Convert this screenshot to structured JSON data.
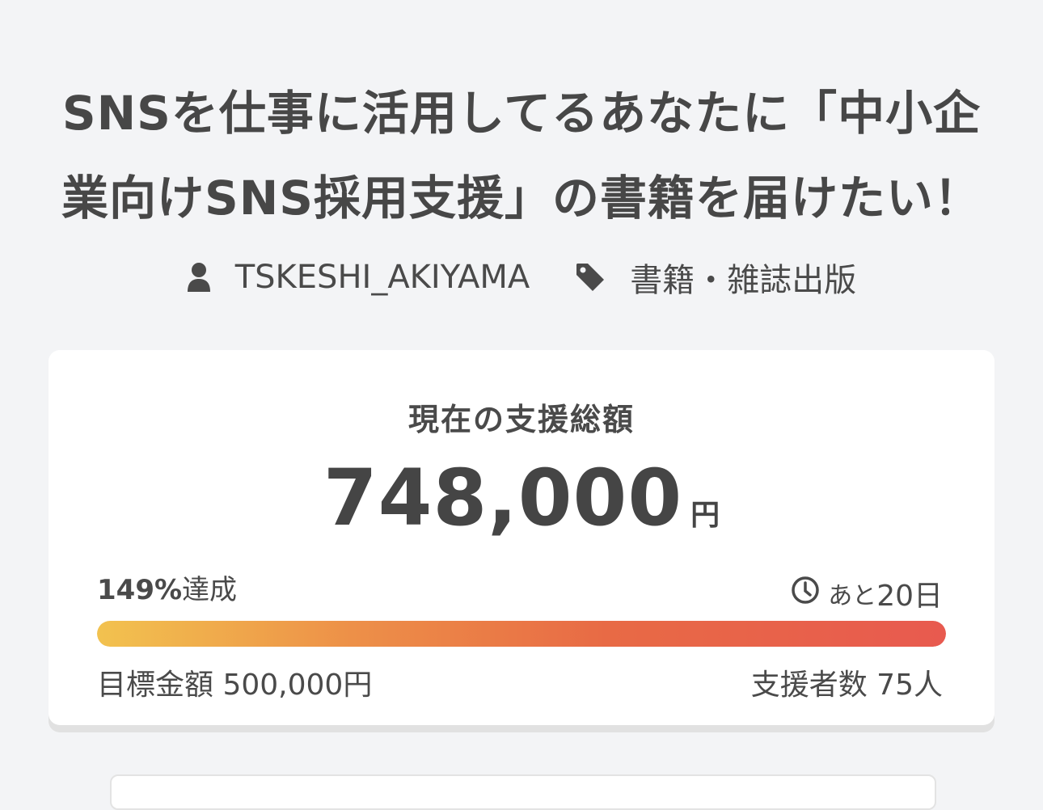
{
  "project": {
    "title_line1": "SNSを仕事に活用してるあなたに「中小企",
    "title_line2": "業向けSNS採用支援」の書籍を届けたい！",
    "author": "TSKESHI_AKIYAMA",
    "category": "書籍・雑誌出版"
  },
  "funding": {
    "label": "現在の支援総額",
    "amount": "748,000",
    "currency": "円",
    "achievement_percent": "149%",
    "achievement_suffix": "達成",
    "progress_fraction": 1.0,
    "remaining_prefix": "あと",
    "remaining_value": "20日",
    "goal_text": "目標金額 500,000円",
    "supporters_text": "支援者数 75人"
  },
  "icons": {
    "author": "user-icon",
    "category": "tag-icon",
    "remaining": "clock-icon"
  },
  "colors": {
    "background": "#f3f4f6",
    "card": "#ffffff",
    "text": "#474747",
    "progress_start": "#f2c24f",
    "progress_end": "#e85a4f"
  }
}
